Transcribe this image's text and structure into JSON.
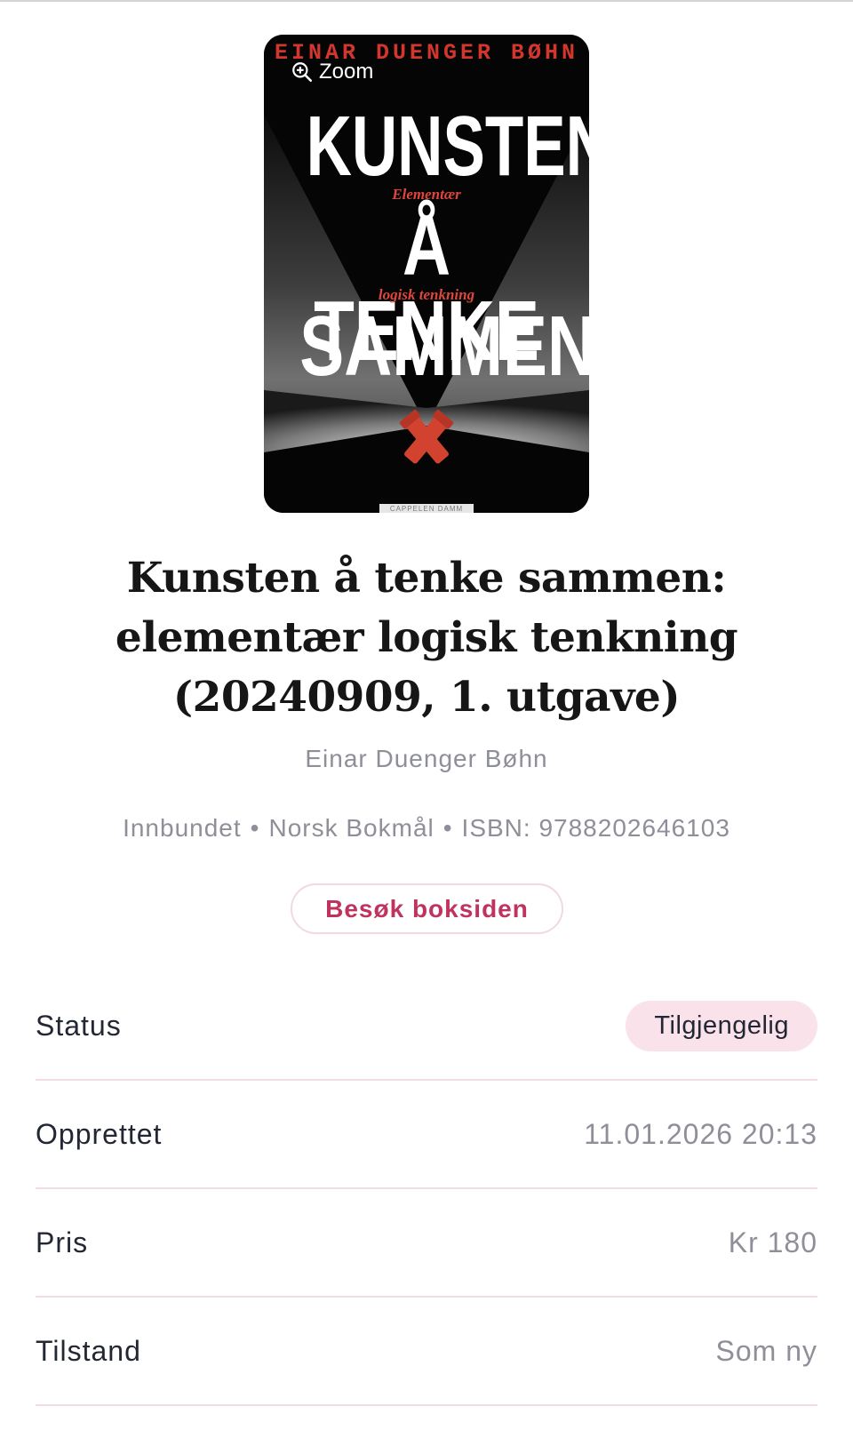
{
  "cover": {
    "author_text": "EINAR DUENGER BØHN",
    "zoom_label": "Zoom",
    "title_lines": [
      "KUNSTEN",
      "Å TENKE",
      "SAMMEN"
    ],
    "subtitle_lines": [
      "Elementær",
      "logisk tenkning"
    ],
    "publisher_text": "CAPPELEN DAMM",
    "colors": {
      "background": "#050505",
      "accent": "#d2362d",
      "title": "#ffffff"
    }
  },
  "book": {
    "title": "Kunsten å tenke sammen: elementær logisk tenkning (20240909, 1. utgave)",
    "author": "Einar Duenger Bøhn",
    "meta": {
      "binding": "Innbundet",
      "language": "Norsk Bokmål",
      "isbn": "ISBN: 9788202646103",
      "separator": "•"
    },
    "visit_button_label": "Besøk boksiden"
  },
  "details": [
    {
      "label": "Status",
      "value": "Tilgjengelig",
      "type": "badge"
    },
    {
      "label": "Opprettet",
      "value": "11.01.2026 20:13",
      "type": "text"
    },
    {
      "label": "Pris",
      "value": "Kr 180",
      "type": "text"
    },
    {
      "label": "Tilstand",
      "value": "Som ny",
      "type": "text"
    }
  ],
  "theme": {
    "accent": "#c0335f",
    "badge_bg": "#f9e2ea",
    "divider": "#f3dde4",
    "muted_text": "#8e8f98"
  },
  "icons": {
    "zoom": "zoom-in-icon",
    "cover_emblem": "crossed-flashlights-icon"
  }
}
